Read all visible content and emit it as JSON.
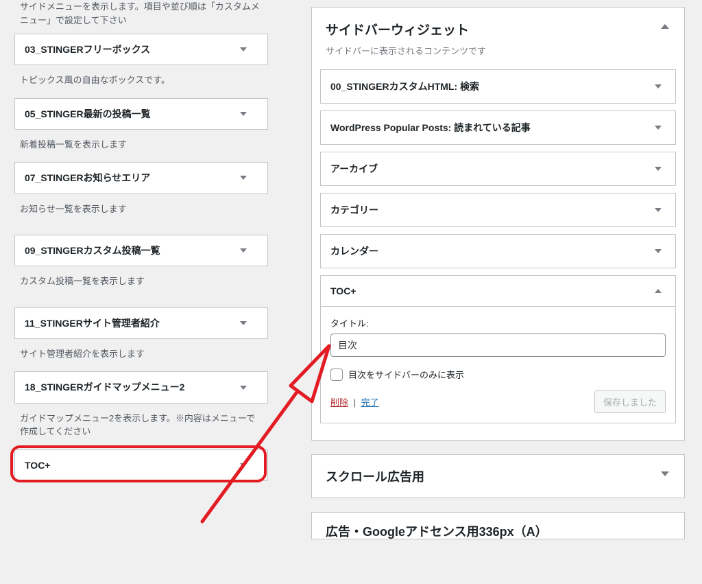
{
  "left": {
    "intro": "サイドメニューを表示します。項目や並び順は「カスタムメニュー」で設定して下さい",
    "items": [
      {
        "title": "03_STINGERフリーボックス",
        "desc": "トピックス風の自由なボックスです。"
      },
      {
        "title": "05_STINGER最新の投稿一覧",
        "desc": "新着投稿一覧を表示します"
      },
      {
        "title": "07_STINGERお知らせエリア",
        "desc": "お知らせ一覧を表示します",
        "gap_after": true
      },
      {
        "title": "09_STINGERカスタム投稿一覧",
        "desc": "カスタム投稿一覧を表示します",
        "gap_after": true
      },
      {
        "title": "11_STINGERサイト管理者紹介",
        "desc": "サイト管理者紹介を表示します"
      },
      {
        "title": "18_STINGERガイドマップメニュー2",
        "desc": "ガイドマップメニュー2を表示します。※内容はメニューで作成してください"
      },
      {
        "title": "TOC+",
        "desc": "",
        "highlighted": true
      }
    ]
  },
  "right": {
    "sidebar_panel": {
      "title": "サイドバーウィジェット",
      "subtitle": "サイドバーに表示されるコンテンツです",
      "items": [
        {
          "label": "00_STINGERカスタムHTML: 検索",
          "open": false
        },
        {
          "label": "WordPress Popular Posts: 読まれている記事",
          "open": false
        },
        {
          "label": "アーカイブ",
          "open": false
        },
        {
          "label": "カテゴリー",
          "open": false
        },
        {
          "label": "カレンダー",
          "open": false
        },
        {
          "label": "TOC+",
          "open": true
        }
      ],
      "toc_form": {
        "title_label": "タイトル:",
        "title_value": "目次",
        "checkbox_label": "目次をサイドバーのみに表示",
        "delete": "削除",
        "done": "完了",
        "saved": "保存しました"
      }
    },
    "scroll_panel": {
      "title": "スクロール広告用"
    },
    "cut_panel": {
      "title": "広告・Googleアドセンス用336px（A）"
    }
  },
  "annotation": {
    "color": "#e31b23"
  }
}
